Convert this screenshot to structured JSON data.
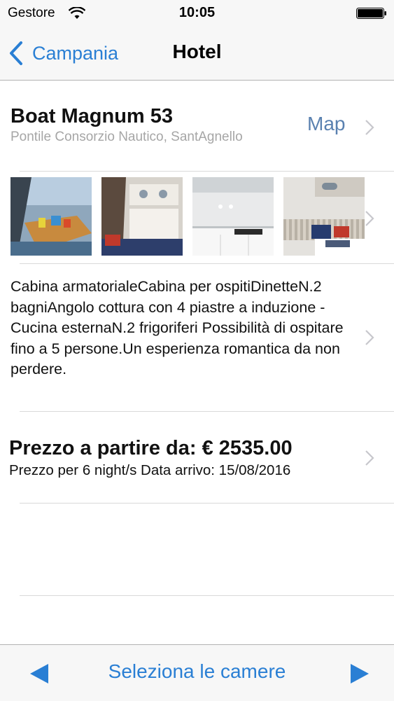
{
  "status_bar": {
    "carrier": "Gestore",
    "time": "10:05",
    "wifi_icon": "wifi-icon",
    "battery_icon": "battery-icon"
  },
  "nav": {
    "back_label": "Campania",
    "title": "Hotel"
  },
  "hotel": {
    "name": "Boat Magnum 53",
    "address": "Pontile Consorzio Nautico, SantAgnello",
    "map_label": "Map"
  },
  "gallery": {
    "photos": [
      "boat-deck-photo",
      "boat-cabin-photo",
      "boat-kitchen-photo",
      "boat-dinette-photo"
    ]
  },
  "description": "Cabina armatorialeCabina per ospitiDinetteN.2 bagniAngolo  cottura con 4 piastre a induzione - Cucina esternaN.2 frigoriferi Possibilità di ospitare fino a 5 persone.Un esperienza romantica da non perdere.",
  "price": {
    "title": "Prezzo a partire da: € 2535.00",
    "subtitle": "Prezzo per 6 night/s Data arrivo: 15/08/2016"
  },
  "toolbar": {
    "label": "Seleziona le camere",
    "accent_color": "#2a7fd4"
  }
}
